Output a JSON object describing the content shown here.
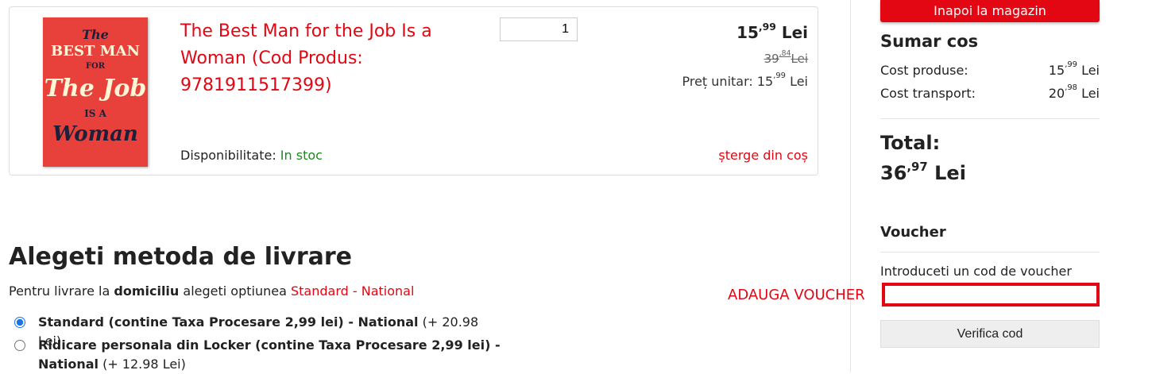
{
  "product": {
    "title": "The Best Man for the Job Is a Woman (Cod Produs: 9781911517399)",
    "cover_text": {
      "line1": "The",
      "line2": "BEST MAN",
      "line3": "FOR",
      "line4": "The Job",
      "line5": "IS A",
      "line6": "Woman"
    },
    "quantity": "1",
    "price_int": "15",
    "price_dec": ",99",
    "price_currency": " Lei",
    "old_price_int": "39",
    "old_price_dec": ",84",
    "old_price_currency": "Lei",
    "unit_price_label": "Preț unitar: ",
    "unit_price_int": "15",
    "unit_price_dec": ",99",
    "unit_price_currency": " Lei",
    "availability_label": "Disponibilitate: ",
    "availability_value": "In stoc",
    "remove_label": "șterge din coș"
  },
  "delivery": {
    "title": "Alegeti metoda de livrare",
    "hint_prefix": "Pentru livrare la ",
    "hint_bold": "domiciliu",
    "hint_middle": " alegeti optiunea ",
    "hint_red": "Standard - National",
    "options": [
      {
        "bold": "Standard (contine Taxa Procesare 2,99 lei) - National",
        "extra": " (+ 20.98 Lei)",
        "selected": true
      },
      {
        "bold": "Ridicare personala din Locker (contine Taxa Procesare 2,99 lei) - National",
        "extra": " (+ 12.98 Lei)",
        "selected": false
      }
    ]
  },
  "sidebar": {
    "back_button": "Inapoi la magazin",
    "summary_title": "Sumar cos",
    "products_cost_label": "Cost produse:",
    "products_cost_int": "15",
    "products_cost_dec": ",99",
    "products_cost_currency": " Lei",
    "transport_cost_label": "Cost transport:",
    "transport_cost_int": "20",
    "transport_cost_dec": ",98",
    "transport_cost_currency": " Lei",
    "total_label": "Total:",
    "total_int": "36",
    "total_dec": ",97",
    "total_currency": " Lei",
    "voucher_title": "Voucher",
    "voucher_hint": "Introduceti un cod de voucher",
    "voucher_annotation": "ADAUGA VOUCHER",
    "voucher_input_value": "",
    "verify_button": "Verifica cod"
  },
  "colors": {
    "accent": "#e30613",
    "in_stock": "#1a8a1a"
  }
}
